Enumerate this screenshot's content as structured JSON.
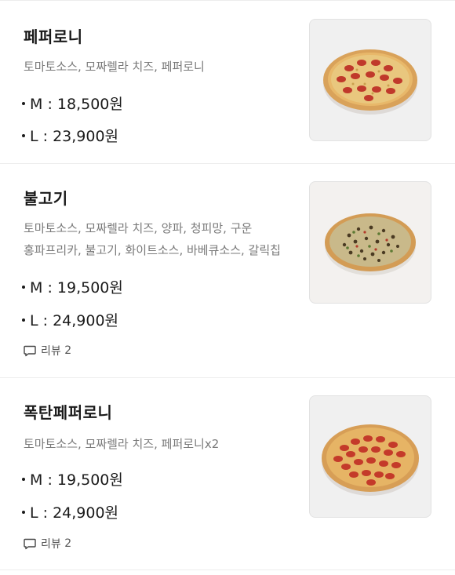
{
  "menu": [
    {
      "name": "페퍼로니",
      "ingredients": "토마토소스, 모짜렐라 치즈, 페퍼로니",
      "prices": [
        {
          "size": "M",
          "price": "18,500원"
        },
        {
          "size": "L",
          "price": "23,900원"
        }
      ]
    },
    {
      "name": "불고기",
      "ingredients_line1": "토마토소스, 모짜렐라 치즈, 양파, 청피망, 구운",
      "ingredients_line2": "홍파프리카, 불고기, 화이트소스, 바베큐소스, 갈릭칩",
      "prices": [
        {
          "size": "M",
          "price": "19,500원"
        },
        {
          "size": "L",
          "price": "24,900원"
        }
      ],
      "review_label": "리뷰",
      "review_count": "2"
    },
    {
      "name": "폭탄페퍼로니",
      "ingredients": "토마토소스, 모짜렐라 치즈, 페퍼로니x2",
      "prices": [
        {
          "size": "M",
          "price": "19,500원"
        },
        {
          "size": "L",
          "price": "24,900원"
        }
      ],
      "review_label": "리뷰",
      "review_count": "2"
    }
  ],
  "colors": {
    "text_primary": "#1a1a1a",
    "text_secondary": "#7a7a7a",
    "divider": "#ededed"
  },
  "icons": {
    "review": "speech-bubble-icon",
    "image": "pizza-image"
  }
}
